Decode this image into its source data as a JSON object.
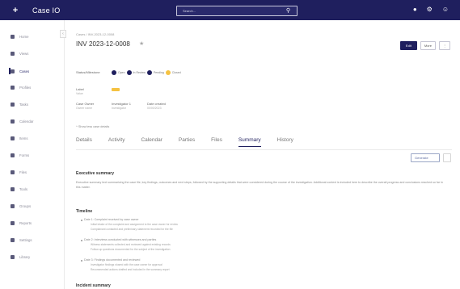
{
  "app": {
    "name": "Case IO"
  },
  "search": {
    "placeholder": "Search..."
  },
  "sidebar": {
    "items": [
      {
        "label": "Home"
      },
      {
        "label": "Views"
      },
      {
        "label": "Cases"
      },
      {
        "label": "Profiles"
      },
      {
        "label": "Tasks"
      },
      {
        "label": "Calendar"
      },
      {
        "label": "Items"
      },
      {
        "label": "Forms"
      },
      {
        "label": "Files"
      },
      {
        "label": "Tools"
      },
      {
        "label": "Groups"
      },
      {
        "label": "Reports"
      },
      {
        "label": "Settings"
      },
      {
        "label": "Library"
      }
    ]
  },
  "case": {
    "breadcrumb": "Cases / INV-2023-12-0008",
    "title": "INV 2023-12-0008",
    "actions": {
      "edit": "Edit",
      "more": "More"
    },
    "stage_label": "Status/Milestone",
    "stages": [
      "Open",
      "In Review",
      "Pending",
      "Closed"
    ],
    "fields_row1": {
      "label": "Label",
      "value": "Value"
    },
    "fields_row2": [
      {
        "label": "Case Owner",
        "value": "Owner name"
      },
      {
        "label": "Investigator 1",
        "value": "Investigator"
      },
      {
        "label": "Date created",
        "value": "00/00/2023"
      }
    ],
    "collapse_link": "^ Show less case details"
  },
  "tabs": [
    "Details",
    "Activity",
    "Calendar",
    "Parties",
    "Files",
    "Summary",
    "History"
  ],
  "summary": {
    "toolbar": {
      "dropdown": "Generate"
    },
    "executive_heading": "Executive summary",
    "executive_text": "Executive summary text summarizing the case file, key findings, outcomes and next steps, followed by the supporting details that were considered during the course of the investigation. Additional context is included here to describe the overall progress and conclusions reached so far in this matter.",
    "timeline_heading": "Timeline",
    "timeline": [
      {
        "title": "Date 1: Complaint received by case owner",
        "subs": [
          "Initial intake of the complaint and assignment to the case owner for review",
          "Complainant contacted and preliminary statement recorded for the file"
        ]
      },
      {
        "title": "Date 2: Interviews conducted with witnesses and parties",
        "subs": [
          "Witness statements collected and reviewed against existing records",
          "Follow-up questions documented for the subject of the investigation"
        ]
      },
      {
        "title": "Date 3: Findings documented and reviewed",
        "subs": [
          "Investigator findings shared with the case owner for approval",
          "Recommended actions drafted and included in the summary report"
        ]
      }
    ],
    "incident_heading": "Incident summary"
  }
}
